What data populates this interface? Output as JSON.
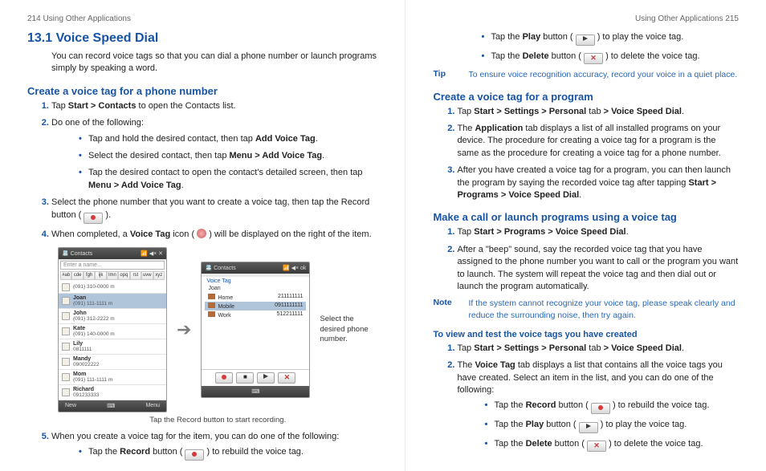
{
  "left": {
    "runner": "214  Using Other Applications",
    "h1": "13.1  Voice Speed Dial",
    "intro": "You can record voice tags so that you can dial a phone number or launch programs simply by speaking a word.",
    "sec1": {
      "title": "Create a voice tag for a phone number",
      "s1_pre": "Tap ",
      "s1_b": "Start > Contacts",
      "s1_post": " to open the Contacts list.",
      "s2": "Do one of the following:",
      "b1_pre": "Tap and hold the desired contact, then tap ",
      "b1_b": "Add Voice Tag",
      "b1_post": ".",
      "b2_pre": "Select the desired contact, then tap ",
      "b2_b": "Menu > Add Voice Tag",
      "b2_post": ".",
      "b3_pre": "Tap the desired contact to open the contact's detailed screen, then tap ",
      "b3_b": "Menu > Add Voice Tag",
      "b3_post": ".",
      "s3": "Select the phone number that you want to create a voice tag, then tap the Record button ( ",
      "s3_post": " ).",
      "s4_pre": "When completed, a ",
      "s4_b": "Voice Tag",
      "s4_mid": " icon ( ",
      "s4_post": " ) will be displayed on the right of the item.",
      "sidecap": "Select the desired phone number.",
      "caption": "Tap the Record button to start recording.",
      "s5": "When you create a voice tag for the item, you can do one of the following:",
      "b4_pre": "Tap the ",
      "b4_b": "Record",
      "b4_mid": " button ( ",
      "b4_post": " ) to rebuild the voice tag."
    },
    "phone1": {
      "title": "Contacts",
      "search": "Enter a name...",
      "keys": [
        "#ab",
        "cde",
        "fgh",
        "ijk",
        "lmn",
        "opq",
        "rst",
        "uvw",
        "xyz"
      ],
      "c1n": "(091) 310-0000",
      "c1l": "m",
      "c2": "Joan",
      "c2a": "(091) 111-1111",
      "c2al": "m",
      "c3": "John",
      "c3a": "(091) 312-2222",
      "c3al": "m",
      "c4": "Kate",
      "c4a": "(091) 140-0000",
      "c4al": "m",
      "c5": "Lily",
      "c5a": "0811111",
      "c6": "Mandy",
      "c6a": "090022222",
      "c7": "Mom",
      "c7a": "(091) 111-1111",
      "c7al": "m",
      "c8": "Richard",
      "c8a": "091233333",
      "botL": "New",
      "botR": "Menu"
    },
    "phone2": {
      "title": "Contacts",
      "head": "Voice Tag",
      "name": "Joan",
      "r1a": "Home",
      "r1b": "211111111",
      "r2a": "Mobile",
      "r2b": "0911111111",
      "r3a": "Work",
      "r3b": "512211111",
      "botR": "ok"
    }
  },
  "right": {
    "runner": "Using Other Applications  215",
    "top": {
      "b1_pre": "Tap the ",
      "b1_b": "Play",
      "b1_mid": " button ( ",
      "b1_post": " ) to play the voice tag.",
      "b2_pre": "Tap the ",
      "b2_b": "Delete",
      "b2_mid": " button ( ",
      "b2_post": " ) to delete the voice tag."
    },
    "tip": {
      "label": "Tip",
      "text": "To ensure voice recognition accuracy, record your voice in a quiet place."
    },
    "sec2": {
      "title": "Create a voice tag for a program",
      "s1_pre": "Tap ",
      "s1_b": "Start > Settings > Personal",
      "s1_mid": " tab ",
      "s1_b2": "> Voice Speed Dial",
      "s1_post": ".",
      "s2_pre": "The ",
      "s2_b": "Application",
      "s2_post": " tab displays a list of all installed programs on your device. The procedure for creating a voice tag for a program is the same as the procedure for creating a voice tag for a phone number.",
      "s3_pre": "After you have created a voice tag for a program, you can then launch the program by saying the recorded voice tag after tapping ",
      "s3_b": "Start > Programs > Voice Speed Dial",
      "s3_post": "."
    },
    "sec3": {
      "title": "Make a call or launch programs using a voice tag",
      "s1_pre": "Tap ",
      "s1_b": "Start > Programs > Voice Speed Dial",
      "s1_post": ".",
      "s2": "After a \"beep\" sound, say the recorded voice tag that you have assigned to the phone number you want to call or the program you want to launch. The system will repeat the voice tag and then dial out or launch the program automatically."
    },
    "note": {
      "label": "Note",
      "text": "If the system cannot recognize your voice tag, please speak clearly and reduce the surrounding noise, then try again."
    },
    "sec4": {
      "title": "To view and test the voice tags you have created",
      "s1_pre": "Tap ",
      "s1_b": "Start > Settings > Personal",
      "s1_mid": " tab ",
      "s1_b2": "> Voice Speed Dial",
      "s1_post": ".",
      "s2_pre": "The ",
      "s2_b": "Voice Tag",
      "s2_post": " tab displays a list that contains all the voice tags you have created. Select an item in the list, and you can do one of the following:",
      "b1_pre": "Tap the ",
      "b1_b": "Record",
      "b1_mid": " button ( ",
      "b1_post": " ) to rebuild the voice tag.",
      "b2_pre": "Tap the ",
      "b2_b": "Play",
      "b2_mid": " button ( ",
      "b2_post": " ) to play the voice tag.",
      "b3_pre": "Tap the ",
      "b3_b": "Delete",
      "b3_mid": " button ( ",
      "b3_post": " ) to delete the voice tag."
    }
  }
}
